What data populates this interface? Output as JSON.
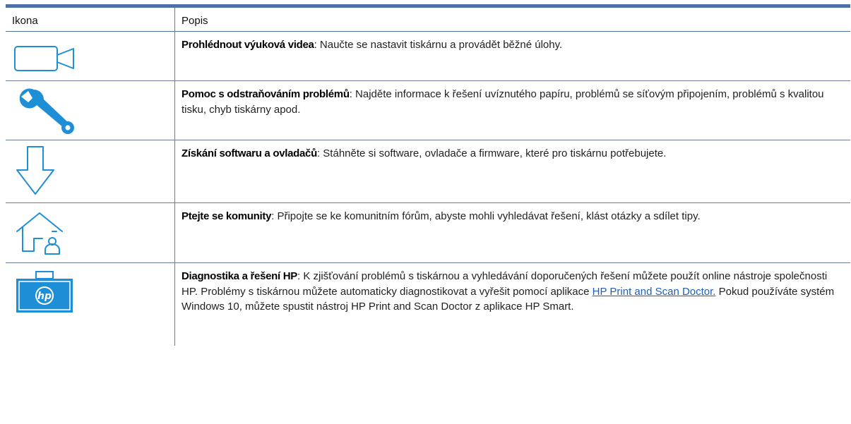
{
  "header": {
    "col_icon": "Ikona",
    "col_desc": "Popis"
  },
  "rows": [
    {
      "icon": "video-camera-icon",
      "term": "Prohlédnout výuková videa",
      "text": ": Naučte se nastavit tiskárnu a provádět běžné úlohy."
    },
    {
      "icon": "wrench-icon",
      "term": "Pomoc s odstraňováním problémů",
      "text": ": Najděte informace k řešení uvíznutého papíru, problémů se síťovým připojením, problémů s kvalitou tisku, chyb tiskárny apod."
    },
    {
      "icon": "download-arrow-icon",
      "term": "Získání softwaru a ovladačů",
      "text": ": Stáhněte si software, ovladače a firmware, které pro tiskárnu potřebujete."
    },
    {
      "icon": "community-home-icon",
      "term": "Ptejte se komunity",
      "text": ": Připojte se ke komunitním fórům, abyste mohli vyhledávat řešení, klást otázky a sdílet tipy."
    },
    {
      "icon": "hp-toolbox-icon",
      "term": "Diagnostika a řešení HP",
      "text": ": K zjišťování problémů s tiskárnou a vyhledávání doporučených řešení můžete použít online nástroje společnosti HP. Problémy s tiskárnou můžete automaticky diagnostikovat a vyřešit pomocí aplikace ",
      "link": "HP Print and Scan Doctor.",
      "text_after": " Pokud používáte systém Windows 10, můžete spustit nástroj HP Print and Scan Doctor z aplikace HP Smart.",
      "logo_text": "hp"
    }
  ],
  "colors": {
    "accent": "#1e8fd6",
    "rule": "#4f6fa8",
    "link": "#1b5fb8"
  }
}
